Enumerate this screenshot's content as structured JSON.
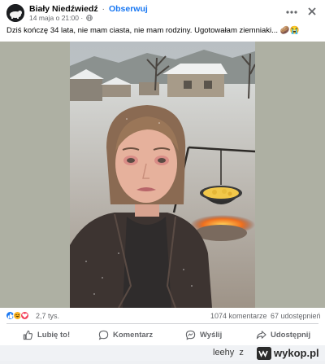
{
  "post": {
    "author": "Biały Niedźwiedź",
    "separator": "·",
    "follow_label": "Obserwuj",
    "timestamp": "14 maja o 21:00",
    "meta_separator": "·",
    "caption": "Dziś kończę 34 lata, nie mam ciasta, nie mam rodziny. Ugotowałam ziemniaki... 🥔😭"
  },
  "stats": {
    "reactions_count": "2,7 tys.",
    "comments": "1074 komentarze",
    "shares": "67 udostępnień",
    "reaction_icons": [
      "like-icon",
      "haha-icon",
      "love-icon"
    ]
  },
  "actions": {
    "like": "Lubię to!",
    "comment": "Komentarz",
    "send": "Wyślij",
    "share": "Udostępnij"
  },
  "watermark": {
    "user": "leehy",
    "z": "z",
    "site": "wykop.pl"
  },
  "colors": {
    "accent": "#1877f2",
    "text": "#050505",
    "secondary": "#65676b",
    "like": "#1877f2",
    "haha": "#f7b125",
    "love": "#f33e58"
  }
}
